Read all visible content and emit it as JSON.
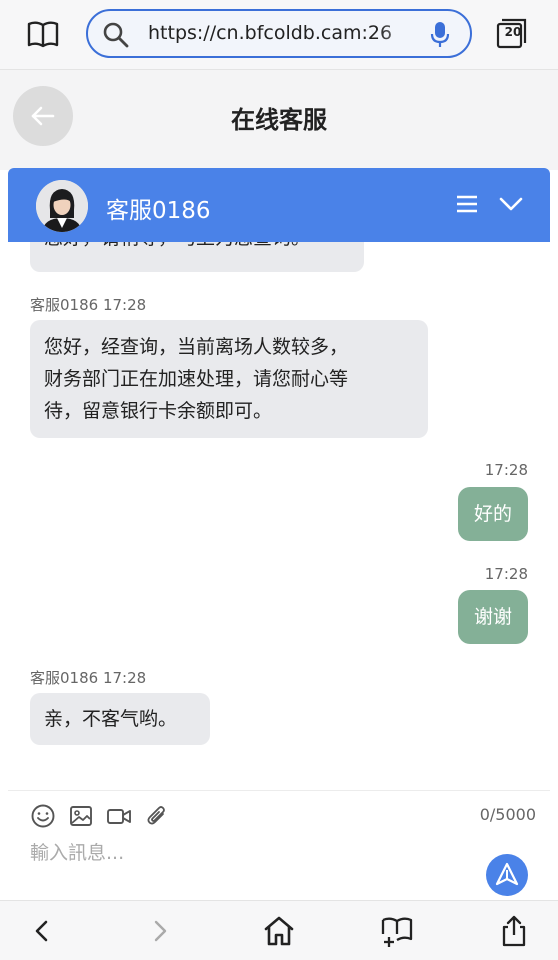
{
  "browser": {
    "url": "https://cn.bfcoldb.cam:26",
    "tab_count": "20"
  },
  "page": {
    "title": "在线客服"
  },
  "chat": {
    "agent_name": "客服0186",
    "messages": [
      {
        "sender": "agent",
        "text": "您好，请稍等，马上为您查询。"
      },
      {
        "sender": "agent",
        "meta": "客服0186 17:28",
        "lines": [
          "您好，经查询，当前离场人数较多，",
          "财务部门正在加速处理，请您耐心等",
          "待，留意银行卡余额即可。"
        ]
      },
      {
        "sender": "user",
        "time": "17:28",
        "text": "好的"
      },
      {
        "sender": "user",
        "time": "17:28",
        "text": "谢谢"
      },
      {
        "sender": "agent",
        "meta": "客服0186 17:28",
        "text": "亲，不客气哟。"
      }
    ]
  },
  "composer": {
    "char_count": "0/5000",
    "placeholder": "輸入訊息..."
  },
  "icons": {
    "accent": "#4a82e8",
    "user_bubble": "#84b097",
    "agent_bubble": "#e9eaed"
  }
}
